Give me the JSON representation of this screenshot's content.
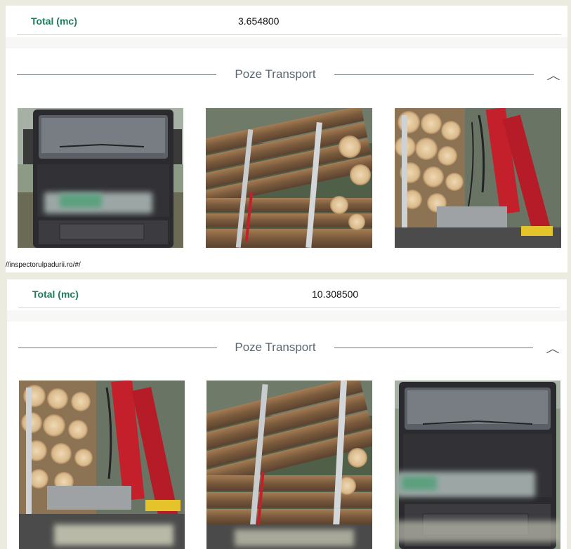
{
  "panels": [
    {
      "total": {
        "label": "Total (mc)",
        "value": "3.654800"
      },
      "section_title": "Poze Transport",
      "photos": [
        {
          "subject": "truck front with blurred plate"
        },
        {
          "subject": "loaded logs on trailer"
        },
        {
          "subject": "logs and red crane"
        }
      ],
      "url": "//inspectorulpadurii.ro/#/"
    },
    {
      "total": {
        "label": "Total (mc)",
        "value": "10.308500"
      },
      "section_title": "Poze Transport",
      "photos": [
        {
          "subject": "logs and red crane"
        },
        {
          "subject": "loaded logs on trailer"
        },
        {
          "subject": "truck front with blurred plate"
        }
      ]
    }
  ],
  "colors": {
    "accent_green": "#1e7a5e",
    "title_gray": "#5b6770",
    "crane_red": "#c4202c"
  },
  "icons": {
    "collapse": "chevron-up-icon"
  }
}
